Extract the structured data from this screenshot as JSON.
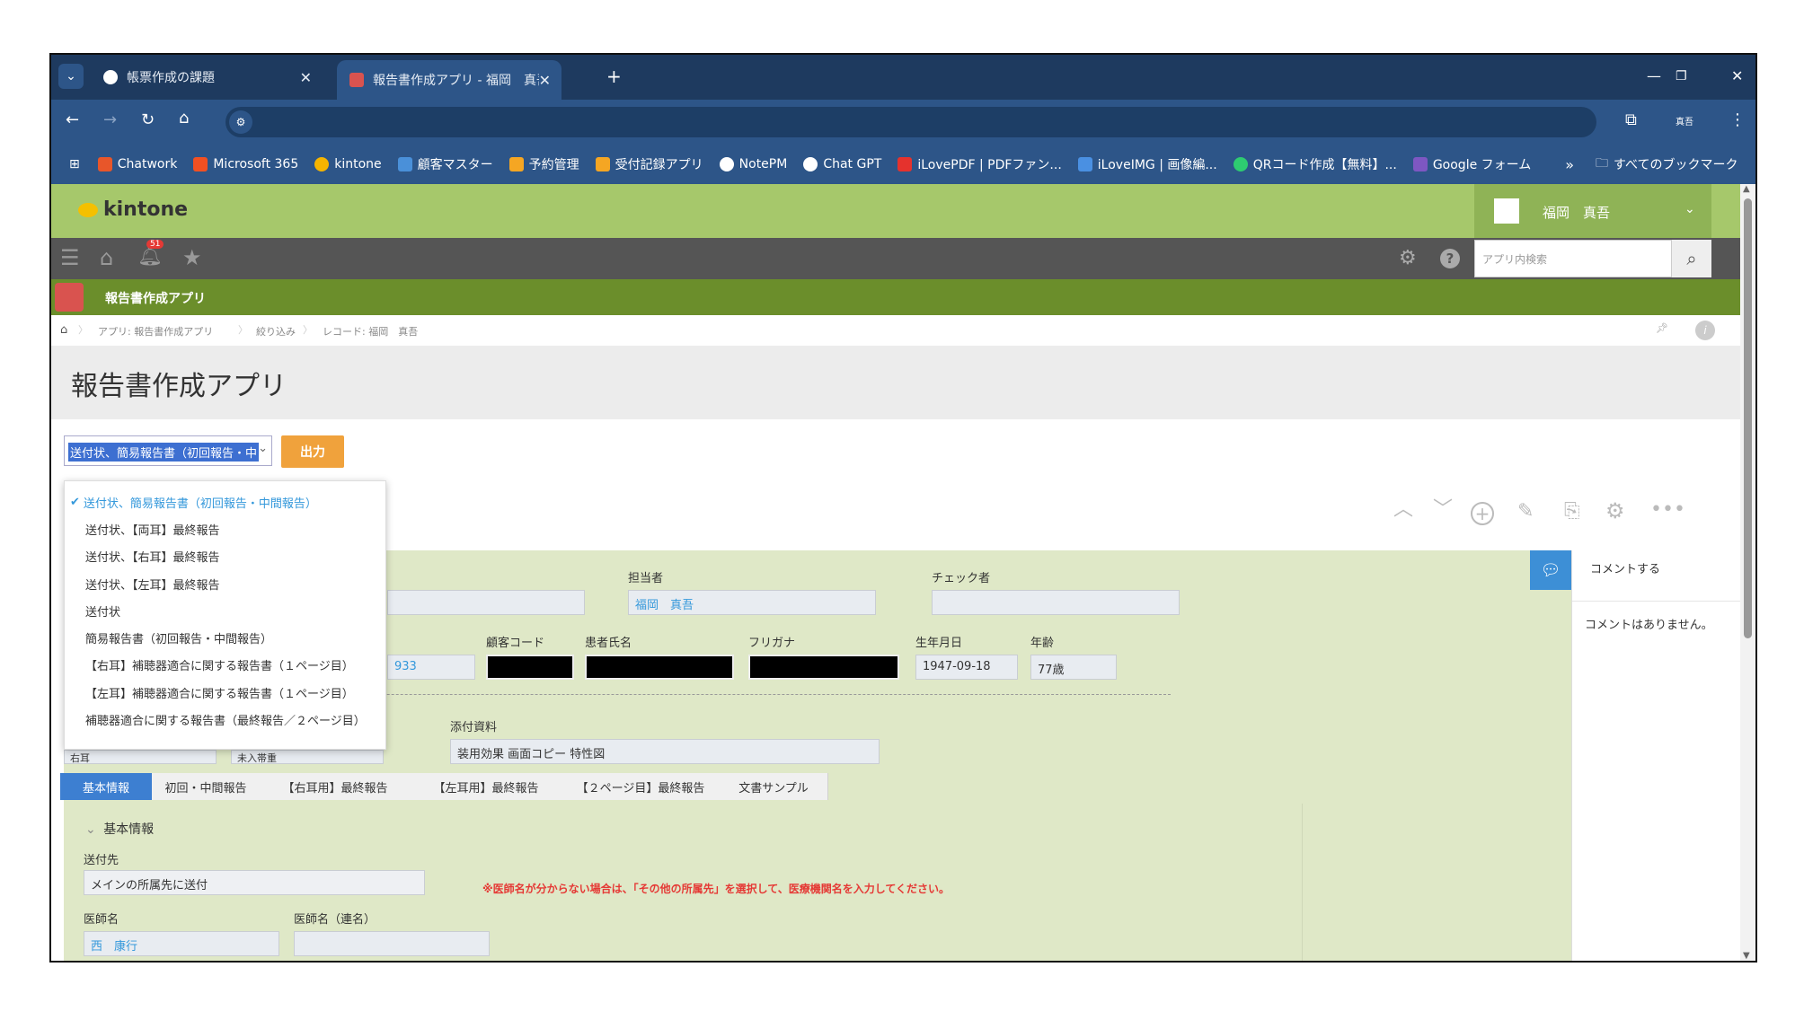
{
  "browser": {
    "tabs": [
      {
        "title": "帳票作成の課題"
      },
      {
        "title": "報告書作成アプリ - 福岡　真吾"
      }
    ],
    "new_tab": "+",
    "profile_initials": "真吾",
    "bookmarks": [
      {
        "label": "Chatwork",
        "color": "#e8562a"
      },
      {
        "label": "Microsoft 365",
        "color": "#f25022"
      },
      {
        "label": "kintone",
        "color": "#f5b400"
      },
      {
        "label": "顧客マスター",
        "color": "#4a90d9"
      },
      {
        "label": "予約管理",
        "color": "#f5a623"
      },
      {
        "label": "受付記録アプリ",
        "color": "#f5a623"
      },
      {
        "label": "NotePM",
        "color": "#ffffff"
      },
      {
        "label": "Chat GPT",
        "color": "#ffffff"
      },
      {
        "label": "iLovePDF | PDFファン...",
        "color": "#e5322d"
      },
      {
        "label": "iLoveIMG | 画像編...",
        "color": "#4a90e2"
      },
      {
        "label": "QRコード作成【無料】...",
        "color": "#2ecc71"
      },
      {
        "label": "Google フォーム",
        "color": "#7e57c2"
      }
    ],
    "more": "»",
    "all_bookmarks": "すべてのブックマーク"
  },
  "kintone": {
    "logo": "kintone",
    "user": "福岡　真吾",
    "notification_count": "51",
    "search_placeholder": "アプリ内検索",
    "app_name": "報告書作成アプリ",
    "breadcrumb": [
      "アプリ: 報告書作成アプリ",
      "絞り込み",
      "レコード: 福岡　真吾"
    ],
    "page_title": "報告書作成アプリ",
    "select_value": "送付状、簡易報告書（初回報告・中",
    "output_button": "出力",
    "dropdown_options": [
      "送付状、簡易報告書（初回報告・中間報告）",
      "送付状、【両耳】最終報告",
      "送付状、【右耳】最終報告",
      "送付状、【左耳】最終報告",
      "送付状",
      "簡易報告書（初回報告・中間報告）",
      "【右耳】補聴器適合に関する報告書（１ページ目）",
      "【左耳】補聴器適合に関する報告書（１ページ目）",
      "補聴器適合に関する報告書（最終報告／２ページ目）"
    ],
    "selected_index": 0,
    "fields": {
      "tantousha_label": "担当者",
      "tantousha_value": "福岡　真吾",
      "checker_label": "チェック者",
      "code_label": "顧客コード",
      "name_label": "患者氏名",
      "kana_label": "フリガナ",
      "birth_label": "生年月日",
      "birth_value": "1947-09-18",
      "age_label": "年齢",
      "age_value": "77歳",
      "partial_value": "933",
      "attach_label": "添付資料",
      "attach_value": "装用効果 画面コピー 特性図",
      "left_partial_1": "右耳",
      "left_partial_2": "未入帯重"
    },
    "tabs": [
      "基本情報",
      "初回・中間報告",
      "【右耳用】最終報告",
      "【左耳用】最終報告",
      "【２ページ目】最終報告",
      "文書サンプル"
    ],
    "section_title": "基本情報",
    "send_to_label": "送付先",
    "send_to_value": "メインの所属先に送付",
    "warning": "※医師名が分からない場合は、「その他の所属先」を選択して、医療機関名を入力してください。",
    "doctor_label": "医師名",
    "doctor_alt_label": "医師名（連名）",
    "doctor_value": "西　康行",
    "comment_button": "コメントする",
    "no_comments": "コメントはありません。"
  },
  "colors": {
    "tab_bg": "#1e3a5f",
    "nav_bg": "#2d5588",
    "kintone_green": "#a6c86b",
    "app_bar": "#6b8e2b",
    "output_orange": "#f0a23c",
    "link_blue": "#3498db",
    "warning_red": "#e53935"
  }
}
